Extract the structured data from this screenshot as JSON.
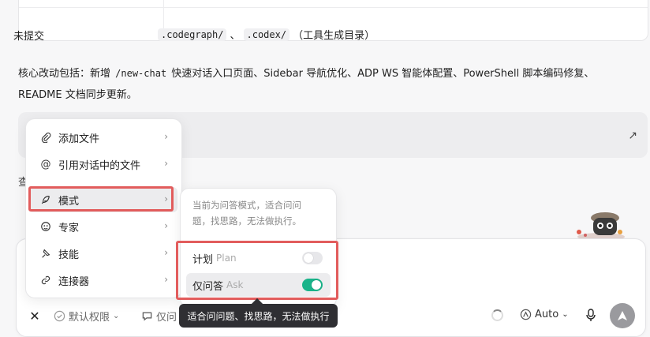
{
  "table": {
    "row_label": "未提交",
    "code_1": ".codegraph/",
    "sep": "、",
    "code_2": ".codex/",
    "suffix": "（工具生成目录）"
  },
  "summary": {
    "prefix": "核心改动包括：新增 ",
    "code": "/new-chat",
    "rest": " 快速对话入口页面、Sidebar 导航优化、ADP WS 智能体配置、PowerShell 脚本编码修复、README 文档同步更新。"
  },
  "peek": {
    "line_1": "查",
    "line_2": "（"
  },
  "menu": {
    "items": [
      {
        "label": "添加文件",
        "icon": "paperclip-icon"
      },
      {
        "label": "引用对话中的文件",
        "icon": "at-icon"
      },
      {
        "label": "模式",
        "icon": "feather-icon"
      },
      {
        "label": "专家",
        "icon": "expert-icon"
      },
      {
        "label": "技能",
        "icon": "skill-icon"
      },
      {
        "label": "连接器",
        "icon": "link-icon"
      }
    ]
  },
  "submenu": {
    "description": "当前为问答模式，适合问问题，找思路，无法做执行。",
    "plan_label": "计划",
    "plan_en": "Plan",
    "ask_label": "仅问答",
    "ask_en": "Ask",
    "plan_on": false,
    "ask_on": true
  },
  "tooltip": "适合问问题、找思路，无法做执行",
  "toolbar": {
    "permission": "默认权限",
    "mode_peek": "仅问",
    "model": "Auto"
  },
  "colors": {
    "accent_toggle": "#19b389",
    "highlight": "#e25c5c"
  }
}
